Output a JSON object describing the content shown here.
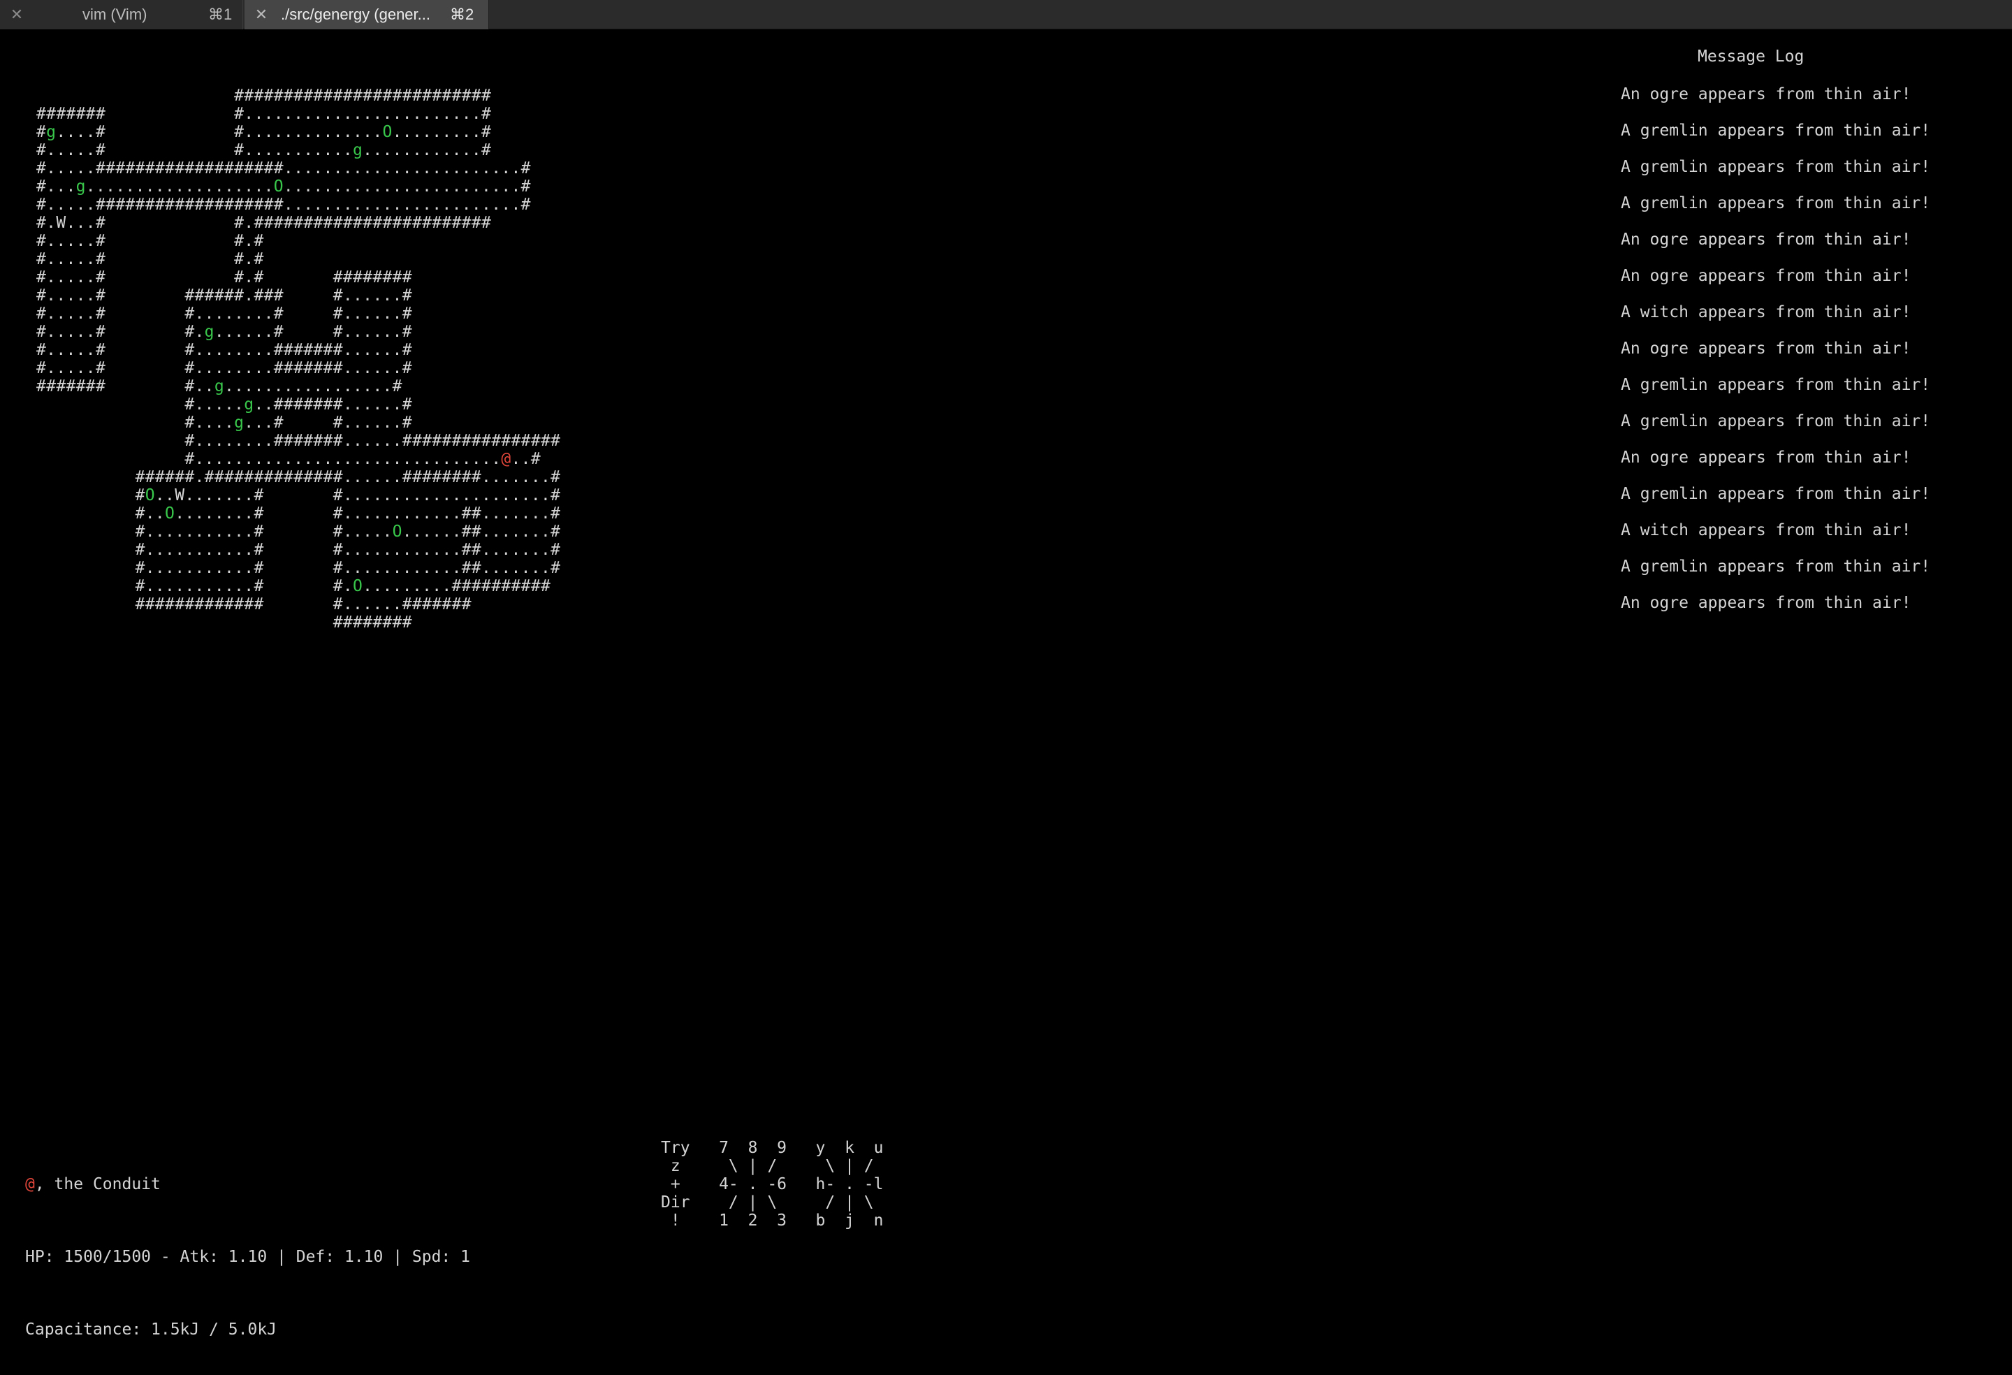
{
  "tabs": [
    {
      "title": "vim (Vim)",
      "shortcut": "⌘1",
      "active": false
    },
    {
      "title": "./src/genergy (gener...",
      "shortcut": "⌘2",
      "active": true
    }
  ],
  "map_rows": [
    "                    ##########################",
    "#######             #........................#",
    "#g....#             #..............O.........#",
    "#.....#             #...........g............#",
    "#.....###################........................#",
    "#...g...................O........................#",
    "#.....###################........................#",
    "#.W...#             #.########################",
    "#.....#             #.#",
    "#.....#             #.#",
    "#.....#             #.#       ########",
    "#.....#        ######.###     #......#",
    "#.....#        #........#     #......#",
    "#.....#        #.g......#     #......#",
    "#.....#        #........#######......#",
    "#.....#        #........#######......#",
    "#######        #..g.................#",
    "               #.....g..#######......#",
    "               #....g...#     #......#",
    "               #........#######......################",
    "               #...............................@..#",
    "          ######.##############......########.......#",
    "          #O..W.......#       #.....................#",
    "          #..O........#       #............##.......#",
    "          #...........#       #.....O......##.......#",
    "          #...........#       #............##.......#",
    "          #...........#       #............##.......#",
    "          #...........#       #.O.........##########",
    "          #############       #......#######",
    "                              ########"
  ],
  "message_log": {
    "title": "Message Log",
    "messages": [
      "An ogre appears from thin air!",
      "A gremlin appears from thin air!",
      "A gremlin appears from thin air!",
      "A gremlin appears from thin air!",
      "An ogre appears from thin air!",
      "An ogre appears from thin air!",
      "A witch appears from thin air!",
      "An ogre appears from thin air!",
      "A gremlin appears from thin air!",
      "A gremlin appears from thin air!",
      "An ogre appears from thin air!",
      "A gremlin appears from thin air!",
      "A witch appears from thin air!",
      "A gremlin appears from thin air!",
      "An ogre appears from thin air!"
    ]
  },
  "status": {
    "player_glyph": "@",
    "player_title": ", the Conduit",
    "stats_line": "HP: 1500/1500 - Atk: 1.10 | Def: 1.10 | Spd: 1",
    "capacitance_line": "Capacitance: 1.5kJ / 5.0kJ"
  },
  "direction_help": [
    "Try   7  8  9   y  k  u",
    " z     \\ | /     \\ | /",
    " +    4- . -6   h- . -l",
    "Dir    / | \\     / | \\",
    " !    1  2  3   b  j  n"
  ],
  "colors": {
    "background": "#000000",
    "text": "#d4d4d4",
    "monster": "#39c74b",
    "player": "#e0453a",
    "tab_active": "#464646",
    "tab_inactive": "#2b2b2b"
  }
}
